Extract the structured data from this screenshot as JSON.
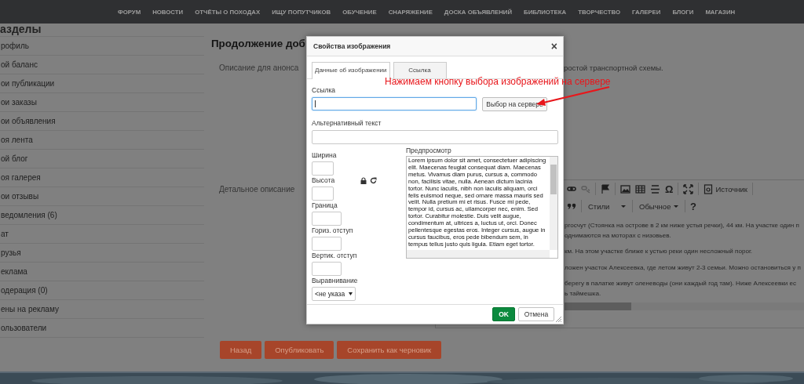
{
  "nav": {
    "items": [
      "ФОРУМ",
      "НОВОСТИ",
      "ОТЧЁТЫ О ПОХОДАХ",
      "ИЩУ ПОПУТЧИКОВ",
      "ОБУЧЕНИЕ",
      "СНАРЯЖЕНИЕ",
      "ДОСКА ОБЪЯВЛЕНИЙ",
      "БИБЛИОТЕКА",
      "ТВОРЧЕСТВО",
      "ГАЛЕРЕИ",
      "БЛОГИ",
      "МАГАЗИН"
    ]
  },
  "sidebar": {
    "title": "азделы",
    "items": [
      "рофиль",
      "ой баланс",
      "ои публикации",
      "ои заказы",
      "ои объявления",
      "оя лента",
      "ой блог",
      "оя галерея",
      "ои отзывы",
      "ведомления (6)",
      "ат",
      "рузья",
      "еклама",
      "одерация (0)",
      "ены на рекламу",
      "ользователи"
    ]
  },
  "main": {
    "title": "Продолжение доб",
    "announce": {
      "label": "Описание для анонса",
      "value": "ростой транспортной схемы."
    },
    "detail": {
      "label": "Детальное описание"
    },
    "editor": {
      "symbol": "Ω",
      "source": "Источник",
      "styles": "Стили",
      "format": "Обычное",
      "help": "?",
      "paragraphs": [
        {
          "lines": [
            "ргосчут (Стоянка на острове в 2 км ниже устья речки), 44 км. На участке один п",
            "однимаются на моторах с низовьев."
          ]
        },
        {
          "lines": [
            "км. На этом участке ближе к устью реки один несложный порог."
          ]
        },
        {
          "lines": [
            "ложен участок Алексеевка, где летом живут 2-3 семьи. Можно остановиться у п"
          ]
        },
        {
          "lines": [
            "берегу в палатке живут оленеводы (они каждый год там). Ниже Алексеевки ес",
            "ь таймешка."
          ]
        }
      ]
    },
    "buttons": [
      "Назад",
      "Опубликовать",
      "Сохранить как черновик"
    ]
  },
  "dialog": {
    "title": "Свойства изображения",
    "close": "×",
    "tabs": [
      {
        "label": "Данные об изображении",
        "selected": true
      },
      {
        "label": "Ссылка",
        "selected": false
      }
    ],
    "url": {
      "label": "Ссылка",
      "focused": true
    },
    "browse_button": "Выбор на сервере",
    "alt": {
      "label": "Альтернативный текст",
      "focused": false
    },
    "fields": [
      {
        "label": "Ширина",
        "kind": "size",
        "ratio_lock": false
      },
      {
        "label": "Высота",
        "kind": "size",
        "ratio_lock": true
      },
      {
        "label": "Граница",
        "kind": "spacing",
        "ratio_lock": false
      },
      {
        "label": "Гориз. отступ",
        "kind": "spacing",
        "ratio_lock": false
      },
      {
        "label": "Вертик. отступ",
        "kind": "spacing",
        "ratio_lock": false
      }
    ],
    "align": {
      "label": "Выравнивание",
      "value": "<не указа"
    },
    "preview": {
      "label": "Предпросмотр",
      "text": "Lorem ipsum dolor sit amet, consectetuer adipiscing elit. Maecenas feugiat consequat diam. Maecenas metus. Vivamus diam purus, cursus a, commodo non, facilisis vitae, nulla. Aenean dictum lacinia tortor. Nunc iaculis, nibh non iaculis aliquam, orci felis euismod neque, sed ornare massa mauris sed velit. Nulla pretium mi et risus. Fusce mi pede, tempor id, cursus ac, ullamcorper nec, enim. Sed tortor. Curabitur molestie. Duis velit augue, condimentum at, ultrices a, luctus ut, orci. Donec pellentesque egestas eros. Integer cursus, augue in cursus faucibus, eros pede bibendum sem, in tempus tellus justo quis ligula. Etiam eget tortor."
    },
    "ok": "OK",
    "cancel": "Отмена"
  },
  "annotation": {
    "text": "Нажимаем кнопку выбора изображений на сервере"
  }
}
